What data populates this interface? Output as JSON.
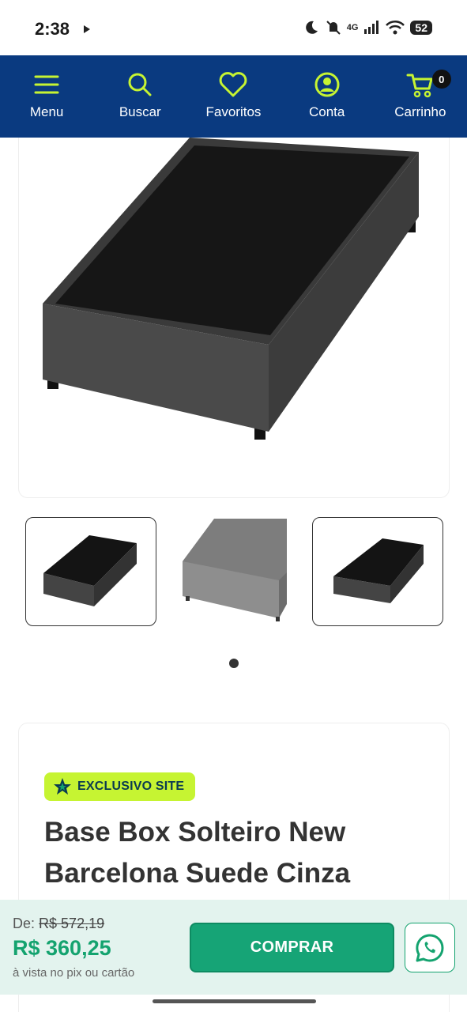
{
  "status_bar": {
    "time": "2:38",
    "battery": "52",
    "network": "4G"
  },
  "nav": {
    "items": [
      {
        "label": "Menu",
        "icon": "menu-icon"
      },
      {
        "label": "Buscar",
        "icon": "search-icon"
      },
      {
        "label": "Favoritos",
        "icon": "heart-icon"
      },
      {
        "label": "Conta",
        "icon": "user-icon"
      },
      {
        "label": "Carrinho",
        "icon": "cart-icon"
      }
    ],
    "cart_count": "0"
  },
  "gallery": {
    "thumbnails": [
      "thumbnail-1",
      "thumbnail-2",
      "thumbnail-3"
    ]
  },
  "product": {
    "badge": "EXCLUSIVO SITE",
    "title": "Base Box Solteiro New Barcelona Suede Cinza"
  },
  "buy_bar": {
    "from_label": "De:",
    "old_price": "R$ 572,19",
    "price": "R$ 360,25",
    "payment_note": "à vista no pix ou cartão",
    "buy_label": "COMPRAR"
  },
  "colors": {
    "nav_bg": "#0a3a80",
    "accent_green": "#16a476",
    "badge_lime": "#c6f432"
  }
}
